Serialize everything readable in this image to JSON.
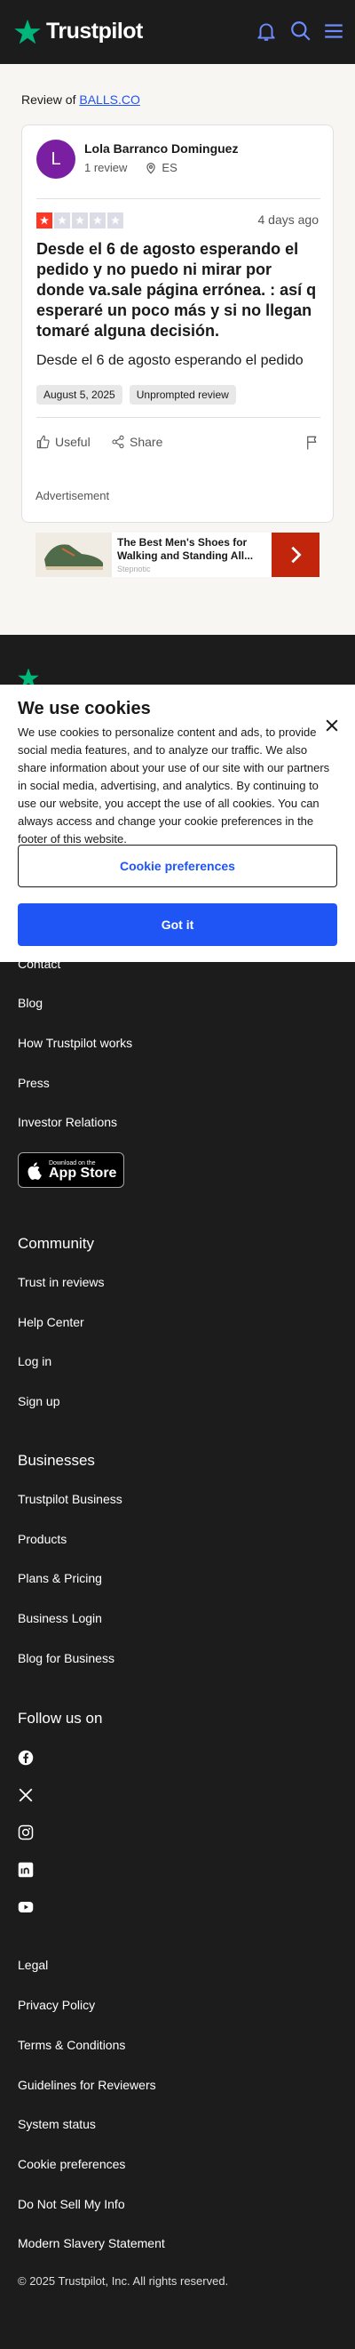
{
  "header": {
    "brand": "Trustpilot",
    "icons": [
      "bell-icon",
      "search-icon",
      "menu-icon"
    ],
    "brand_color": "#00b67a",
    "accent": "#6f8cff"
  },
  "review": {
    "review_of_prefix": "Review of",
    "company": "BALLS.CO",
    "avatar_letter": "L",
    "avatar_color": "#7b1fa2",
    "user_name": "Lola Barranco Dominguez",
    "review_count": "1 review",
    "country": "ES",
    "rating": 1,
    "rating_max": 5,
    "date_relative": "4 days ago",
    "title": "Desde el 6 de agosto esperando el pedido y no puedo ni mirar por donde va.sale página errónea. : así q esperaré un poco más y si no llegan tomaré alguna decisión.",
    "body": "Desde el 6 de agosto esperando el pedido",
    "tags": [
      "August 5, 2025",
      "Unprompted review"
    ],
    "actions": {
      "useful": "Useful",
      "share": "Share"
    }
  },
  "ad": {
    "label": "Advertisement",
    "title": "The Best Men's Shoes for Walking and Standing All...",
    "source": "Stepnotic"
  },
  "cookie": {
    "title": "We use cookies",
    "text": "We use cookies to personalize content and ads, to provide social media features, and to analyze our traffic. We also share information about your use of our site with our partners in social media, advertising, and analytics. By continuing to use our website, you accept the use of all cookies. You can always access and change your cookie preferences in the footer of this website.",
    "preferences_button": "Cookie preferences",
    "got_it_button": "Got it"
  },
  "footer": {
    "about_links": [
      "Contact",
      "Blog",
      "How Trustpilot works",
      "Press",
      "Investor Relations"
    ],
    "appstore": {
      "small": "Download on the",
      "big": "App Store"
    },
    "community_heading": "Community",
    "community_links": [
      "Trust in reviews",
      "Help Center",
      "Log in",
      "Sign up"
    ],
    "business_heading": "Businesses",
    "business_links": [
      "Trustpilot Business",
      "Products",
      "Plans & Pricing",
      "Business Login",
      "Blog for Business"
    ],
    "follow_heading": "Follow us on",
    "social_icons": [
      "facebook-icon",
      "x-icon",
      "instagram-icon",
      "linkedin-icon",
      "youtube-icon"
    ],
    "legal_links": [
      "Legal",
      "Privacy Policy",
      "Terms & Conditions",
      "Guidelines for Reviewers",
      "System status",
      "Cookie preferences",
      "Do Not Sell My Info",
      "Modern Slavery Statement"
    ],
    "copyright": "© 2025 Trustpilot, Inc. All rights reserved."
  }
}
